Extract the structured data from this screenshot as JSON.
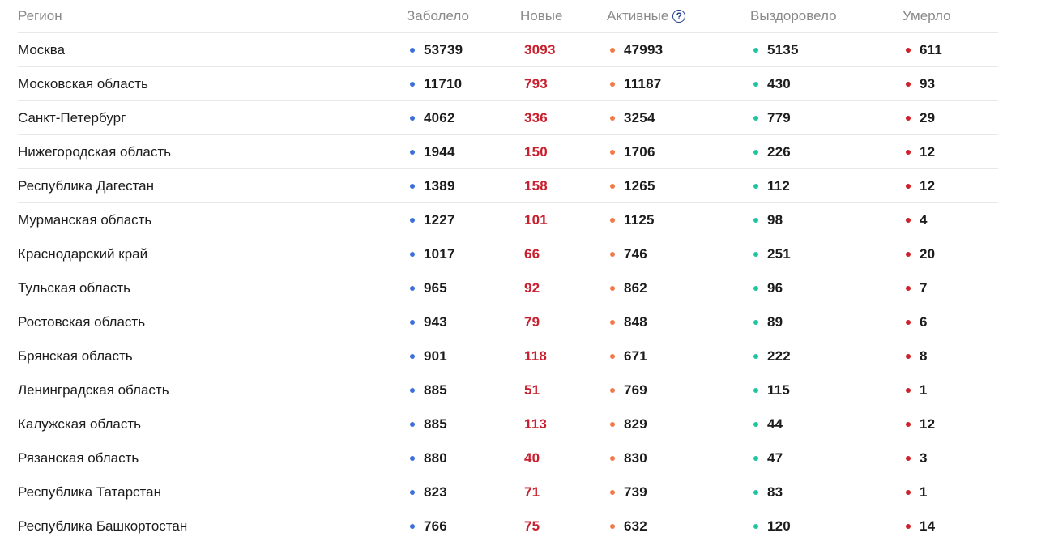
{
  "header": {
    "region": "Регион",
    "total": "Заболело",
    "new": "Новые",
    "active": "Активные",
    "active_help": "?",
    "recovered": "Выздоровело",
    "deaths": "Умерло"
  },
  "colors": {
    "total_dot": "#3d6fd9",
    "active_dot": "#f07a4a",
    "recovered_dot": "#20c4a0",
    "deaths_dot": "#d0202a",
    "new_text": "#c8202e"
  },
  "rows": [
    {
      "region": "Москва",
      "total": "53739",
      "new": "3093",
      "active": "47993",
      "recovered": "5135",
      "deaths": "611"
    },
    {
      "region": "Московская область",
      "total": "11710",
      "new": "793",
      "active": "11187",
      "recovered": "430",
      "deaths": "93"
    },
    {
      "region": "Санкт-Петербург",
      "total": "4062",
      "new": "336",
      "active": "3254",
      "recovered": "779",
      "deaths": "29"
    },
    {
      "region": "Нижегородская область",
      "total": "1944",
      "new": "150",
      "active": "1706",
      "recovered": "226",
      "deaths": "12"
    },
    {
      "region": "Республика Дагестан",
      "total": "1389",
      "new": "158",
      "active": "1265",
      "recovered": "112",
      "deaths": "12"
    },
    {
      "region": "Мурманская область",
      "total": "1227",
      "new": "101",
      "active": "1125",
      "recovered": "98",
      "deaths": "4"
    },
    {
      "region": "Краснодарский край",
      "total": "1017",
      "new": "66",
      "active": "746",
      "recovered": "251",
      "deaths": "20"
    },
    {
      "region": "Тульская область",
      "total": "965",
      "new": "92",
      "active": "862",
      "recovered": "96",
      "deaths": "7"
    },
    {
      "region": "Ростовская область",
      "total": "943",
      "new": "79",
      "active": "848",
      "recovered": "89",
      "deaths": "6"
    },
    {
      "region": "Брянская область",
      "total": "901",
      "new": "118",
      "active": "671",
      "recovered": "222",
      "deaths": "8"
    },
    {
      "region": "Ленинградская область",
      "total": "885",
      "new": "51",
      "active": "769",
      "recovered": "115",
      "deaths": "1"
    },
    {
      "region": "Калужская область",
      "total": "885",
      "new": "113",
      "active": "829",
      "recovered": "44",
      "deaths": "12"
    },
    {
      "region": "Рязанская область",
      "total": "880",
      "new": "40",
      "active": "830",
      "recovered": "47",
      "deaths": "3"
    },
    {
      "region": "Республика Татарстан",
      "total": "823",
      "new": "71",
      "active": "739",
      "recovered": "83",
      "deaths": "1"
    },
    {
      "region": "Республика Башкортостан",
      "total": "766",
      "new": "75",
      "active": "632",
      "recovered": "120",
      "deaths": "14"
    }
  ]
}
